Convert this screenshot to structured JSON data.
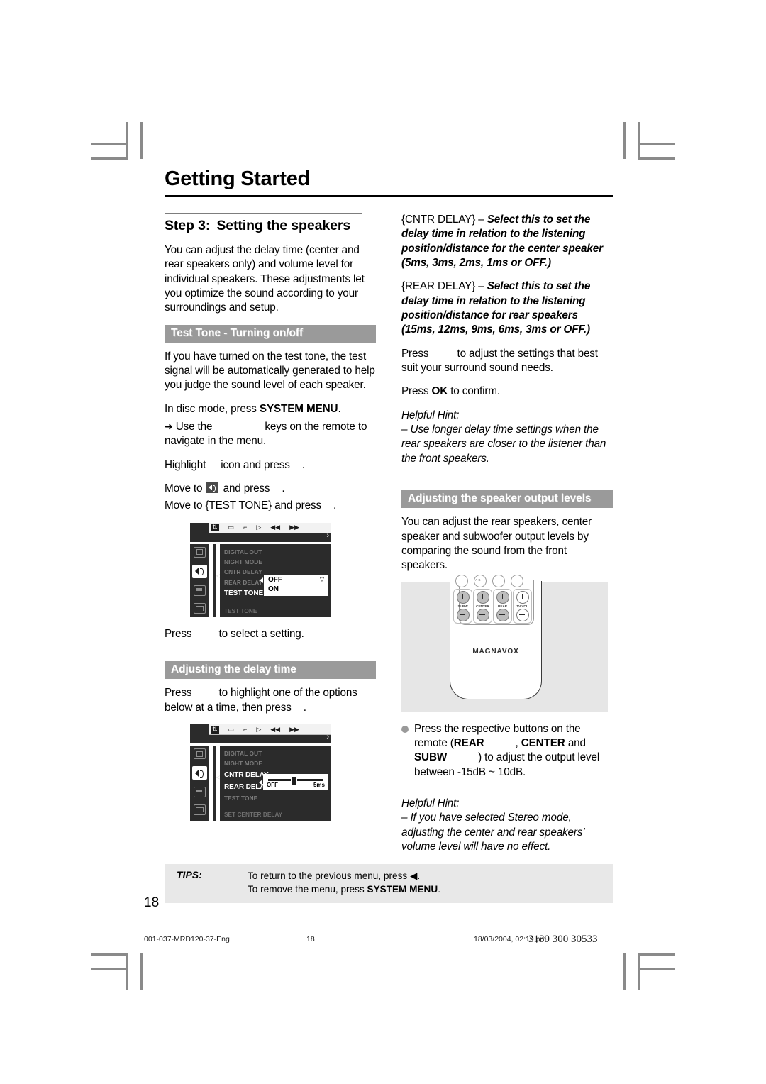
{
  "document": {
    "title": "Getting Started",
    "page_number": "18"
  },
  "left_column": {
    "step_number": "Step 3:",
    "step_title": "Setting the speakers",
    "intro": "You can adjust the delay time (center and rear speakers only) and volume level for individual speakers.  These adjustments let you optimize the sound according to your surroundings and setup.",
    "section_test_tone": {
      "bar_label": "Test Tone - Turning on/off",
      "p1": "If you have turned on the test tone, the test signal will be automatically generated to help you judge the sound level of each speaker.",
      "p2_prefix": "In disc mode, press ",
      "p2_key": "SYSTEM MENU",
      "p2_suffix": ".",
      "p3_arrow": "➜",
      "p3_a": "Use the",
      "p3_b": "keys on the remote to navigate in the menu.",
      "p4_a": "Highlight",
      "p4_b": "icon and press",
      "p4_c": ".",
      "p5_a": "Move to",
      "p5_b": "and press",
      "p5_c": ".",
      "p6_a": "Move to {TEST TONE} and press",
      "p6_b": ".",
      "p7_a": "Press",
      "p7_b": "to select a setting."
    },
    "section_delay": {
      "bar_label": "Adjusting the delay time",
      "p1_a": "Press",
      "p1_b": "to highlight one of the options below at a time, then press",
      "p1_c": "."
    }
  },
  "right_column": {
    "cntr_delay": {
      "term": "{CNTR DELAY}",
      "dash": " – ",
      "desc": "Select this to set the delay time in relation to the listening position/distance for the center speaker (5ms, 3ms, 2ms, 1ms or OFF.)"
    },
    "rear_delay": {
      "term": "{REAR DELAY}",
      "dash": " – ",
      "desc": "Select this to set the delay time in relation to the listening position/distance for rear speakers (15ms, 12ms, 9ms, 6ms, 3ms or OFF.)"
    },
    "press_adjust_a": "Press",
    "press_adjust_b": "to adjust the settings that best suit your surround sound needs.",
    "press_ok_a": "Press ",
    "press_ok_key": "OK",
    "press_ok_b": " to confirm.",
    "hint1_label": "Helpful Hint:",
    "hint1_text": "–  Use longer delay time settings when the rear speakers are closer to the listener than the front speakers.",
    "section_levels": {
      "bar_label": "Adjusting the speaker output levels",
      "p1": "You can adjust the rear speakers, center speaker and subwoofer output levels by comparing the sound from the front speakers."
    },
    "bullet": {
      "a": "Press the respective buttons on the remote (",
      "k1": "REAR",
      "sep": ", ",
      "k2": "CENTER",
      "b": "and ",
      "k3": "SUBW",
      "c": ") to adjust the output level between -15dB ~ 10dB."
    },
    "hint2_label": "Helpful Hint:",
    "hint2_text": "–  If you have selected Stereo mode, adjusting the center and rear speakers’ volume level will have no effect."
  },
  "osd_test_tone": {
    "toolbar_icons": [
      "tools-icon",
      "disc-icon",
      "branch-icon",
      "play-icon",
      "prev-icon",
      "next-icon"
    ],
    "sidebar_icons": [
      "picture-icon",
      "speaker-icon",
      "subtitle-icon",
      "preference-icon"
    ],
    "items": [
      "DIGITAL OUT",
      "NIGHT MODE",
      "CNTR DELAY",
      "REAR DELAY"
    ],
    "highlighted": "TEST TONE",
    "footer": "TEST TONE",
    "options": [
      "OFF",
      "ON"
    ],
    "caret": "▽"
  },
  "osd_delay": {
    "toolbar_icons": [
      "tools-icon",
      "disc-icon",
      "branch-icon",
      "play-icon",
      "prev-icon",
      "next-icon"
    ],
    "sidebar_icons": [
      "picture-icon",
      "speaker-icon",
      "subtitle-icon",
      "preference-icon"
    ],
    "items_dim_top": [
      "DIGITAL OUT",
      "NIGHT MODE"
    ],
    "highlighted": [
      "CNTR DELAY",
      "REAR DELAY"
    ],
    "items_dim_bottom": [
      "TEST TONE"
    ],
    "footer": "SET CENTER DELAY",
    "slider_min_label": "OFF",
    "slider_max_label": "5ms"
  },
  "remote": {
    "brand": "MAGNAVOX",
    "top_button_label": "A-B",
    "button_labels": [
      "SUBW",
      "CENTER",
      "REAR",
      "TV VOL"
    ],
    "plus": "+",
    "minus": "−"
  },
  "tips": {
    "label": "TIPS:",
    "line1_a": "To return to the previous menu, press ",
    "line1_glyph": "◀",
    "line1_b": ".",
    "line2_a": "To remove the menu, press ",
    "line2_key": "SYSTEM MENU",
    "line2_b": "."
  },
  "printer_footer": {
    "filename": "001-037-MRD120-37-Eng",
    "page": "18",
    "timestamp": "18/03/2004, 02:19 pm",
    "code": "3139 300 30533"
  },
  "colors": {
    "bar_gray": "#9a9a9a",
    "tips_gray": "#e8e8e8",
    "osd_dark": "#2b2b2b",
    "remote_bg": "#e6e6e6"
  }
}
